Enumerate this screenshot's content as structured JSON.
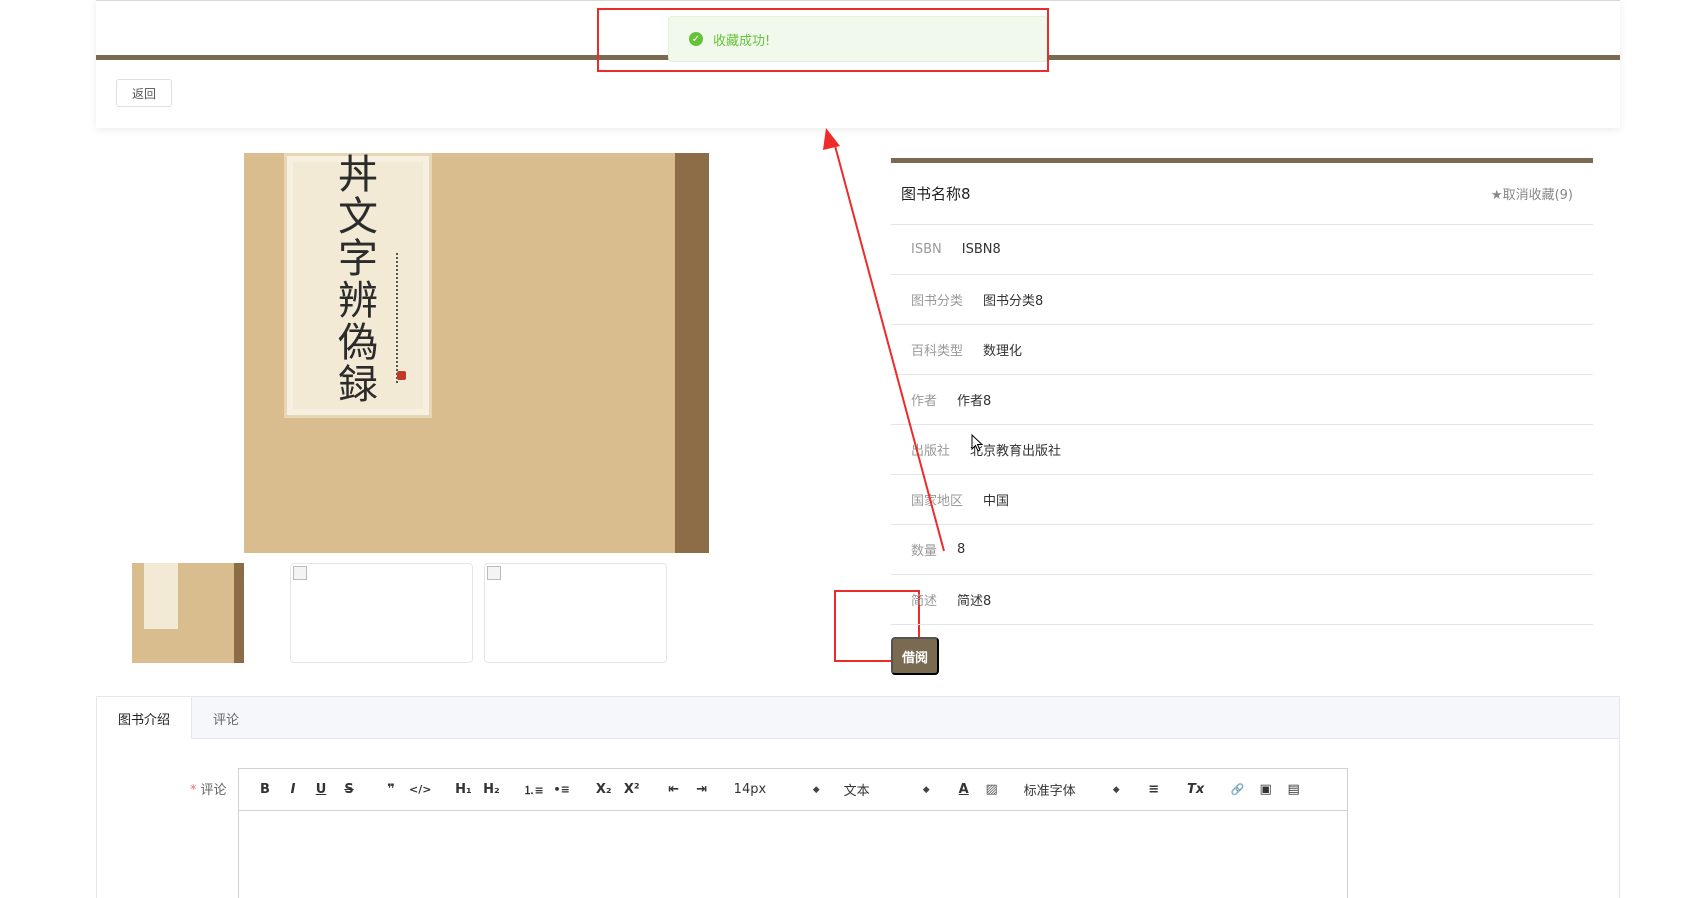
{
  "header": {
    "back_label": "返回"
  },
  "toast": {
    "message": "收藏成功!",
    "icon": "check-circle-icon",
    "color": "#67c23a"
  },
  "gallery": {
    "cover_title": "丼文字辨偽録",
    "thumbnails": [
      "cover",
      "broken-image",
      "broken-image"
    ]
  },
  "book": {
    "name": "图书名称8",
    "unfavorite_label": "★取消收藏(9)",
    "fields": [
      {
        "label": "ISBN",
        "value": "ISBN8"
      },
      {
        "label": "图书分类",
        "value": "图书分类8"
      },
      {
        "label": "百科类型",
        "value": "数理化"
      },
      {
        "label": "作者",
        "value": "作者8"
      },
      {
        "label": "出版社",
        "value": "北京教育出版社"
      },
      {
        "label": "国家地区",
        "value": "中国"
      },
      {
        "label": "数量",
        "value": "8"
      },
      {
        "label": "简述",
        "value": "简述8"
      }
    ],
    "borrow_label": "借阅"
  },
  "tabs": [
    {
      "label": "图书介绍",
      "active": true
    },
    {
      "label": "评论",
      "active": false
    }
  ],
  "comment": {
    "required_mark": "*",
    "label": "评论",
    "toolbar": {
      "bold": "B",
      "italic": "I",
      "underline": "U",
      "strike": "S",
      "quote": "❞",
      "code": "</>",
      "h1": "H₁",
      "h2": "H₂",
      "ordered_list": "⒈≡",
      "bullet_list": "•≡",
      "subscript": "X₂",
      "superscript": "X²",
      "outdent": "⇤",
      "indent": "⇥",
      "size": "14px",
      "text_type": "文本",
      "font": "标准字体",
      "align": "≡",
      "clean": "Tx",
      "link": "🔗",
      "image": "▣",
      "video": "▤"
    }
  },
  "colors": {
    "brand": "#7a6a52",
    "annotation": "#ee2b2b"
  }
}
